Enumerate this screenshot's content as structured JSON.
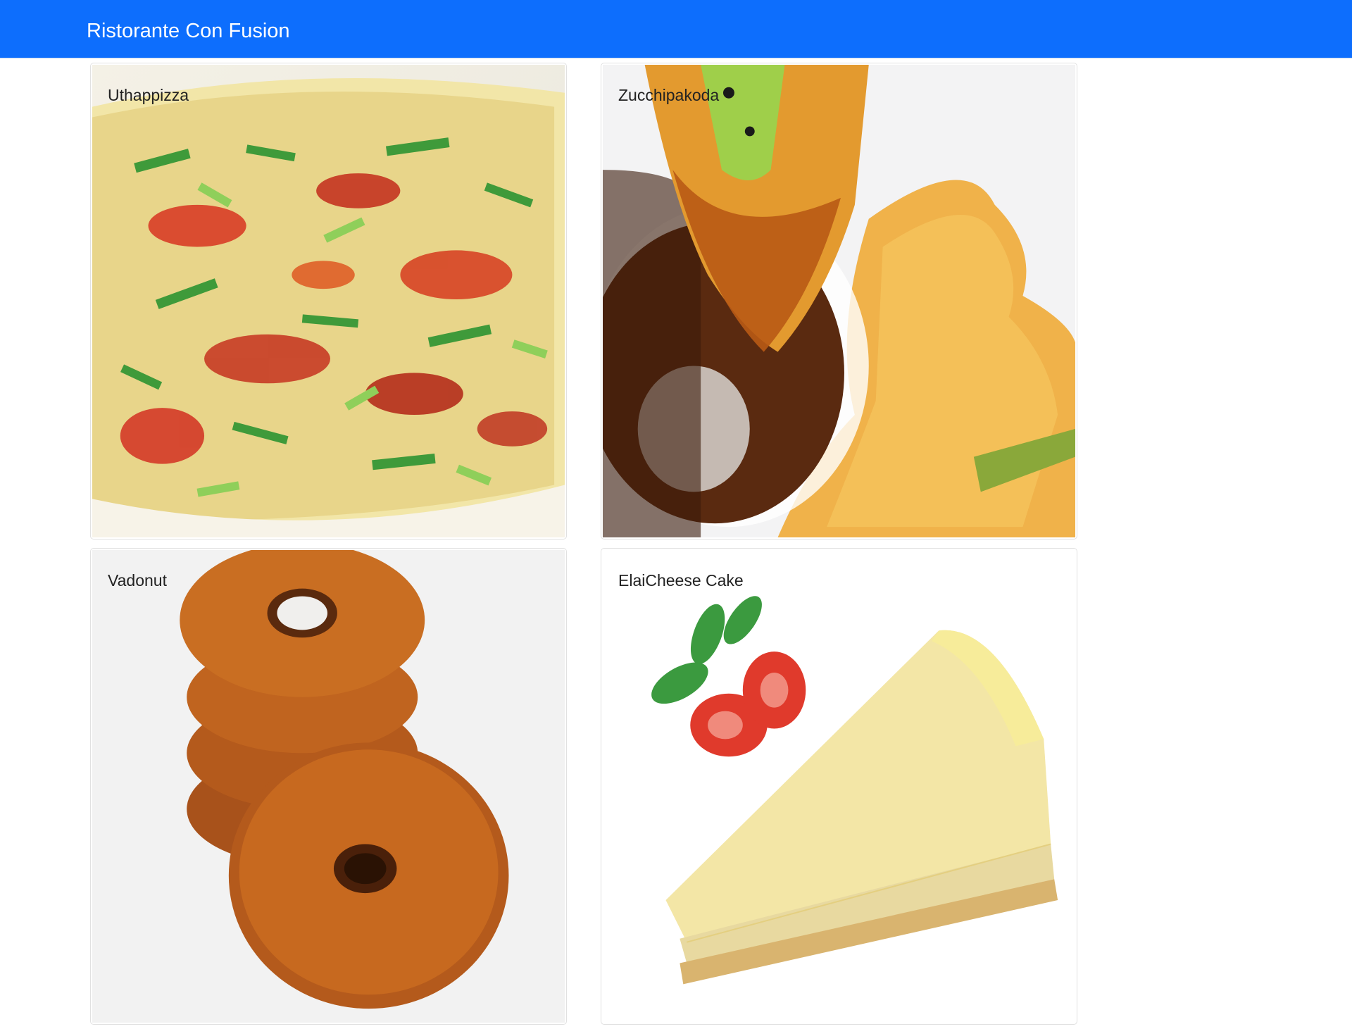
{
  "navbar": {
    "brand": "Ristorante Con Fusion",
    "color": "#0d6efd"
  },
  "dishes": [
    {
      "name": "Uthappizza",
      "image": "uthappizza-photo"
    },
    {
      "name": "Zucchipakoda",
      "image": "zucchipakoda-photo"
    },
    {
      "name": "Vadonut",
      "image": "vadonut-photo"
    },
    {
      "name": "ElaiCheese Cake",
      "image": "elaicheese-cake-photo"
    }
  ]
}
